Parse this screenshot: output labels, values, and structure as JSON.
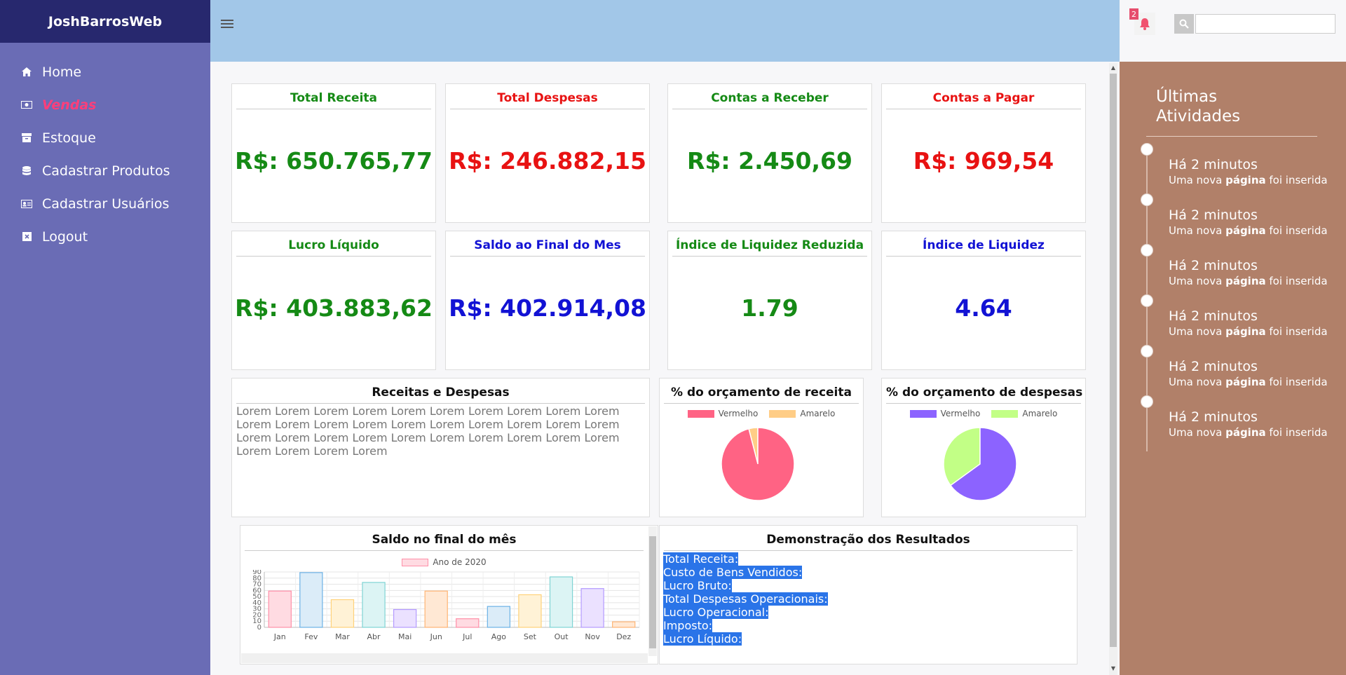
{
  "brand": "JoshBarrosWeb",
  "nav": [
    {
      "label": "Home",
      "icon": "home-icon"
    },
    {
      "label": "Vendas",
      "icon": "money-icon"
    },
    {
      "label": "Estoque",
      "icon": "archive-icon"
    },
    {
      "label": "Cadastrar Produtos",
      "icon": "database-icon"
    },
    {
      "label": "Cadastrar Usuários",
      "icon": "id-card-icon"
    },
    {
      "label": "Logout",
      "icon": "close-box-icon"
    }
  ],
  "header": {
    "notification_count": "2",
    "search_placeholder": ""
  },
  "cards": {
    "total_receita": {
      "title": "Total Receita",
      "value": "R$: 650.765,77"
    },
    "total_despesas": {
      "title": "Total Despesas",
      "value": "R$: 246.882,15"
    },
    "contas_receber": {
      "title": "Contas a Receber",
      "value": "R$: 2.450,69"
    },
    "contas_pagar": {
      "title": "Contas a Pagar",
      "value": "R$: 969,54"
    },
    "lucro_liquido": {
      "title": "Lucro Líquido",
      "value": "R$: 403.883,62"
    },
    "saldo_final": {
      "title": "Saldo ao Final do Mes",
      "value": "R$: 402.914,08"
    },
    "liquidez_reduzida": {
      "title": "Índice de Liquidez Reduzida",
      "value": "1.79"
    },
    "liquidez": {
      "title": "Índice de Liquidez",
      "value": "4.64"
    }
  },
  "receitas_despesas": {
    "title": "Receitas e Despesas",
    "text": "Lorem Lorem Lorem Lorem Lorem Lorem Lorem Lorem Lorem Lorem Lorem Lorem Lorem Lorem Lorem Lorem Lorem Lorem Lorem Lorem Lorem Lorem Lorem Lorem Lorem Lorem Lorem Lorem Lorem Lorem Lorem Lorem Lorem Lorem"
  },
  "orcamento_receita": {
    "title": "% do orçamento de receita",
    "legend": [
      "Vermelho",
      "Amarelo"
    ]
  },
  "orcamento_despesas": {
    "title": "% do orçamento de despesas",
    "legend": [
      "Vermelho",
      "Amarelo"
    ]
  },
  "saldo_mes": {
    "title": "Saldo no final do mês",
    "legend": "Ano de 2020"
  },
  "dre": {
    "title": "Demonstração dos Resultados",
    "lines": [
      "Total Receita:",
      "Custo de Bens Vendidos:",
      "Lucro Bruto:",
      "Total Despesas Operacionais:",
      "Lucro Operacional:",
      "Imposto:",
      "Lucro Líquido:"
    ]
  },
  "activities": {
    "title": "Últimas Atividades",
    "items": [
      {
        "when": "Há 2 minutos",
        "pre": "Uma nova ",
        "bold": "página",
        "post": " foi inserida"
      },
      {
        "when": "Há 2 minutos",
        "pre": "Uma nova ",
        "bold": "página",
        "post": " foi inserida"
      },
      {
        "when": "Há 2 minutos",
        "pre": "Uma nova ",
        "bold": "página",
        "post": " foi inserida"
      },
      {
        "when": "Há 2 minutos",
        "pre": "Uma nova ",
        "bold": "página",
        "post": " foi inserida"
      },
      {
        "when": "Há 2 minutos",
        "pre": "Uma nova ",
        "bold": "página",
        "post": " foi inserida"
      },
      {
        "when": "Há 2 minutos",
        "pre": "Uma nova ",
        "bold": "página",
        "post": " foi inserida"
      }
    ]
  },
  "colors": {
    "pie_receita": [
      "#ff6384",
      "#ffcd86"
    ],
    "pie_despesas": [
      "#8c63ff",
      "#c2ff86"
    ],
    "bar_fills": [
      "#ffdbe2",
      "#dbecf8",
      "#fff2d6",
      "#dcf4f4",
      "#ebe1ff",
      "#ffe8d4",
      "#ffdbe2",
      "#dbecf8",
      "#fff2d6",
      "#dcf4f4",
      "#ebe1ff",
      "#ffe8d4"
    ],
    "bar_strokes": [
      "#ff8fa8",
      "#6cb2e6",
      "#ffd27a",
      "#7fd4d4",
      "#b49bff",
      "#ffb575",
      "#ff8fa8",
      "#6cb2e6",
      "#ffd27a",
      "#7fd4d4",
      "#b49bff",
      "#ffb575"
    ]
  },
  "chart_data": [
    {
      "type": "pie",
      "title": "% do orçamento de receita",
      "labels": [
        "Vermelho",
        "Amarelo"
      ],
      "values": [
        96,
        4
      ]
    },
    {
      "type": "pie",
      "title": "% do orçamento de despesas",
      "labels": [
        "Vermelho",
        "Amarelo"
      ],
      "values": [
        65,
        35
      ]
    },
    {
      "type": "bar",
      "title": "Saldo no final do mês",
      "categories": [
        "Jan",
        "Fev",
        "Mar",
        "Abr",
        "Mai",
        "Jun",
        "Jul",
        "Ago",
        "Set",
        "Out",
        "Nov",
        "Dez"
      ],
      "series": [
        {
          "name": "Ano de 2020",
          "values": [
            59,
            89,
            45,
            73,
            29,
            59,
            14,
            34,
            53,
            82,
            63,
            9
          ]
        }
      ],
      "ylim": [
        0,
        90
      ],
      "yticks": [
        0,
        10,
        20,
        30,
        40,
        50,
        60,
        70,
        80,
        90
      ],
      "grid": true,
      "legend_position": "top"
    }
  ]
}
